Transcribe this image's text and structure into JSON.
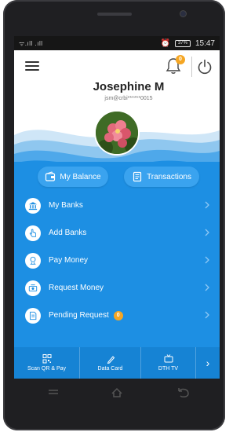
{
  "status": {
    "signal_text": "ᯤ.ıll .ıll",
    "battery": "37%",
    "time": "15:47"
  },
  "header": {
    "notification_count": "0"
  },
  "profile": {
    "name": "Josephine M",
    "email": "jsm@crbi******0015"
  },
  "quick_actions": [
    {
      "label": "My Balance",
      "icon": "wallet-icon"
    },
    {
      "label": "Transactions",
      "icon": "receipt-icon"
    }
  ],
  "menu": [
    {
      "label": "My Banks",
      "icon": "bank-icon"
    },
    {
      "label": "Add Banks",
      "icon": "hand-pointer-icon"
    },
    {
      "label": "Pay Money",
      "icon": "pay-icon"
    },
    {
      "label": "Request Money",
      "icon": "request-money-icon"
    },
    {
      "label": "Pending Request",
      "icon": "pending-document-icon",
      "badge": "0"
    }
  ],
  "bottom_nav": [
    {
      "label": "Scan QR & Pay",
      "icon": "qr-code-icon"
    },
    {
      "label": "Data Card",
      "icon": "pen-icon"
    },
    {
      "label": "DTH TV",
      "icon": "tv-icon"
    },
    {
      "label": "›",
      "icon": "chevron-right-icon"
    }
  ],
  "colors": {
    "primary_blue": "#1d8fe3",
    "pill_blue": "#3aa3ef",
    "nav_blue": "#1683d4",
    "badge_orange": "#f5a623"
  }
}
